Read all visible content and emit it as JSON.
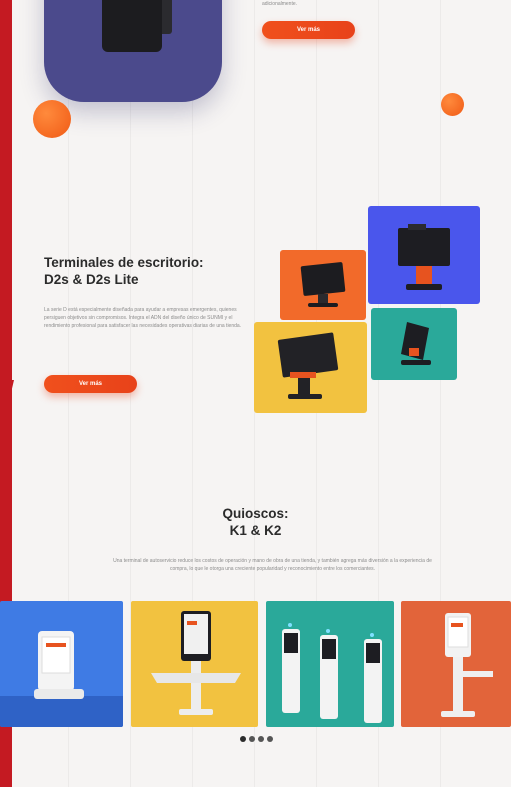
{
  "top": {
    "caption": "adicionalmente.",
    "button_label": "Ver más"
  },
  "desktop": {
    "title_line1": "Terminales de escritorio:",
    "title_line2": "D2s & D2s Lite",
    "paragraph": "La serie D está especialmente diseñada para ayudar a empresas emergentes, quienes persiguen objetivos sin compromisos. Integra el ADN del diseño único de SUNMI y el rendimiento profesional para satisfacer las necesidades operativas diarias de una tienda.",
    "button_label": "Ver más"
  },
  "kiosk": {
    "title_line1": "Quioscos:",
    "title_line2": "K1 & K2",
    "paragraph": "Una terminal de autoservicio reduce los costos de operación y mano de obra de una tienda, y también agrega más diversión a la experiencia de compra, lo que le otorga una creciente popularidad y reconocimiento entre los comerciantes."
  },
  "carousel": {
    "total_dots": 4,
    "active_index": 0
  },
  "colors": {
    "brand_red": "#c41a22",
    "accent_orange": "#f0501c",
    "tile_blue": "#4a56ec",
    "tile_orange": "#f26a2a",
    "tile_yellow": "#f2c240",
    "tile_teal": "#2aa99a",
    "card_purple": "#4b4a8c"
  }
}
